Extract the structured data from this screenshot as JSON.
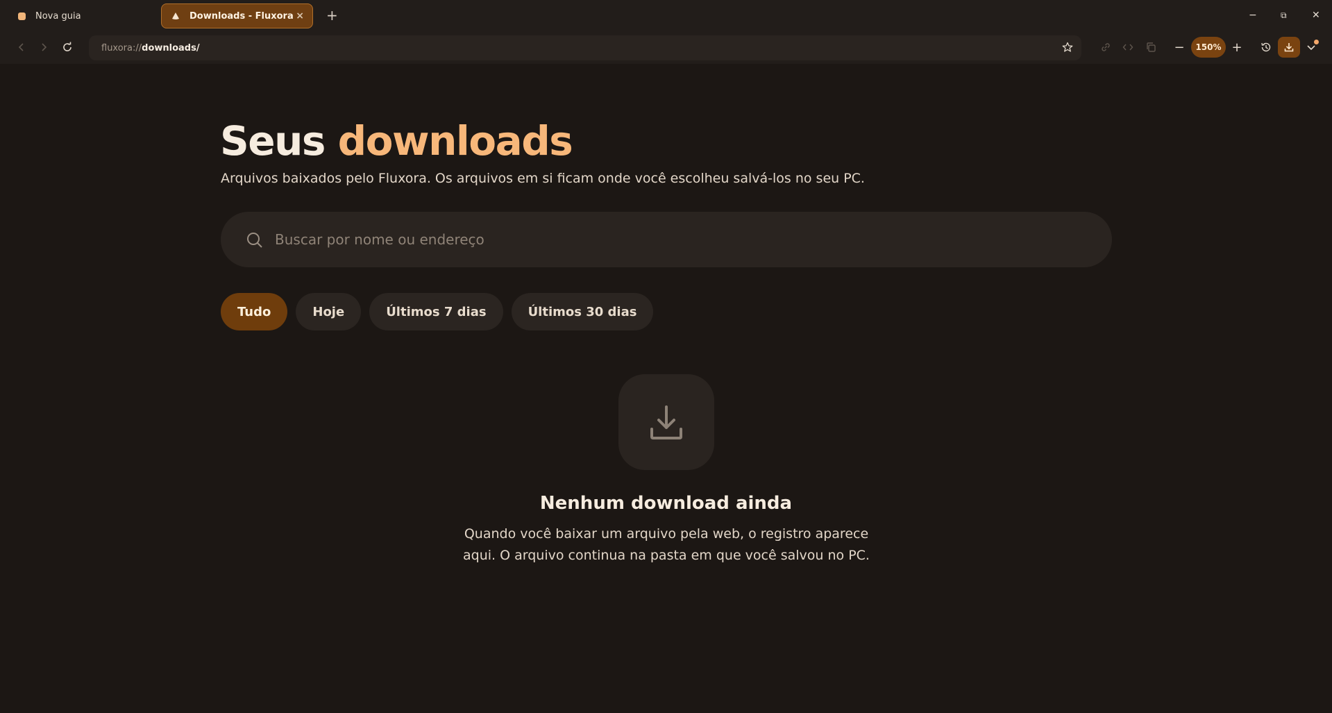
{
  "tabs": [
    {
      "label": "Nova guia"
    },
    {
      "label": "Downloads - Fluxora"
    }
  ],
  "tab_close": "×",
  "new_tab": "+",
  "window": {
    "minimize": "−",
    "maximize": "⧉",
    "close": "✕"
  },
  "omnibox": {
    "scheme": "fluxora://",
    "host": "downloads/"
  },
  "zoom": {
    "level": "150%",
    "minus": "−",
    "plus": "+"
  },
  "page": {
    "title_part1": "Seus ",
    "title_part2": "downloads",
    "subtitle": "Arquivos baixados pelo Fluxora. Os arquivos em si ficam onde você escolheu salvá-los no seu PC.",
    "search_placeholder": "Buscar por nome ou endereço",
    "filters": [
      {
        "label": "Tudo",
        "active": true
      },
      {
        "label": "Hoje"
      },
      {
        "label": "Últimos 7 dias"
      },
      {
        "label": "Últimos 30 dias"
      }
    ],
    "empty_title": "Nenhum download ainda",
    "empty_desc": "Quando você baixar um arquivo pela web, o registro aparece aqui. O arquivo continua na pasta em que você salvou no PC."
  },
  "colors": {
    "accent": "#f7b77a",
    "active_chip": "#6f3d0c",
    "background": "#1c1714"
  },
  "icons": [
    "back-icon",
    "forward-icon",
    "reload-icon",
    "bookmark-star-icon",
    "link-icon",
    "code-icon",
    "copy-icon",
    "history-icon",
    "download-icon",
    "chevron-down-icon",
    "search-icon"
  ]
}
